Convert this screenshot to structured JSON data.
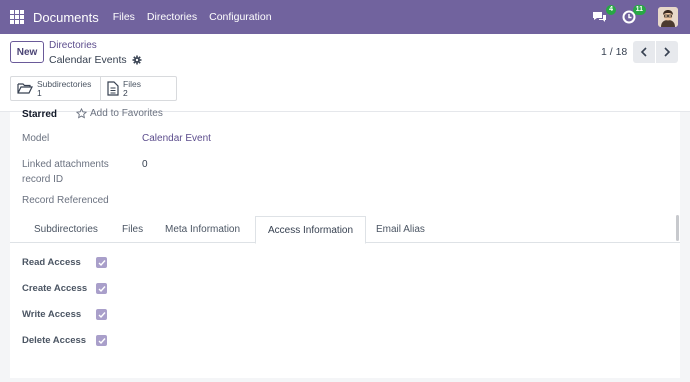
{
  "navbar": {
    "app_name": "Documents",
    "menu": [
      "Files",
      "Directories",
      "Configuration"
    ],
    "messages_count": "4",
    "activities_count": "11"
  },
  "control_panel": {
    "new_label": "New",
    "breadcrumb_parent": "Directories",
    "breadcrumb_current": "Calendar Events",
    "pager": "1 / 18",
    "smart_buttons": [
      {
        "label": "Subdirectories",
        "value": "1",
        "icon": "folder-open-icon"
      },
      {
        "label": "Files",
        "value": "2",
        "icon": "file-text-icon"
      }
    ]
  },
  "form": {
    "starred_label": "Starred",
    "add_favorites_label": "Add to Favorites",
    "model_label": "Model",
    "model_value": "Calendar Event",
    "linked_label_line1": "Linked attachments",
    "linked_label_line2": "record ID",
    "linked_value": "0",
    "record_referenced_label": "Record Referenced",
    "tabs": [
      "Subdirectories",
      "Files",
      "Meta Information",
      "Access Information",
      "Email Alias"
    ],
    "active_tab": "Access Information",
    "access": [
      {
        "label": "Read Access",
        "checked": true
      },
      {
        "label": "Create Access",
        "checked": true
      },
      {
        "label": "Write Access",
        "checked": true
      },
      {
        "label": "Delete Access",
        "checked": true
      }
    ]
  },
  "colors": {
    "navbar": "#71639e",
    "accent": "#5c4d8d",
    "checkbox": "#a99fca",
    "badge": "#28a745"
  }
}
